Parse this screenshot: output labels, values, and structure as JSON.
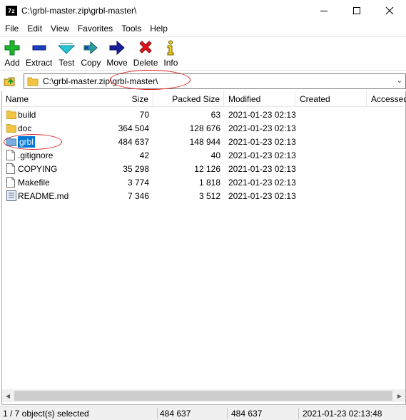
{
  "window": {
    "app_icon_text": "7z",
    "title": "C:\\grbl-master.zip\\grbl-master\\"
  },
  "menu": [
    "File",
    "Edit",
    "View",
    "Favorites",
    "Tools",
    "Help"
  ],
  "toolbar": {
    "add": "Add",
    "extract": "Extract",
    "test": "Test",
    "copy": "Copy",
    "move": "Move",
    "delete": "Delete",
    "info": "Info"
  },
  "address": {
    "path": "C:\\grbl-master.zip\\grbl-master\\"
  },
  "columns": {
    "name": "Name",
    "size": "Size",
    "packed": "Packed Size",
    "modified": "Modified",
    "created": "Created",
    "accessed": "Accessed"
  },
  "files": [
    {
      "name": "build",
      "size": "70",
      "packed": "63",
      "modified": "2021-01-23 02:13",
      "type": "folder"
    },
    {
      "name": "doc",
      "size": "364 504",
      "packed": "128 676",
      "modified": "2021-01-23 02:13",
      "type": "folder"
    },
    {
      "name": "grbl",
      "size": "484 637",
      "packed": "148 944",
      "modified": "2021-01-23 02:13",
      "type": "folder-selected"
    },
    {
      "name": ".gitignore",
      "size": "42",
      "packed": "40",
      "modified": "2021-01-23 02:13",
      "type": "file"
    },
    {
      "name": "COPYING",
      "size": "35 298",
      "packed": "12 126",
      "modified": "2021-01-23 02:13",
      "type": "file"
    },
    {
      "name": "Makefile",
      "size": "3 774",
      "packed": "1 818",
      "modified": "2021-01-23 02:13",
      "type": "file"
    },
    {
      "name": "README.md",
      "size": "7 346",
      "packed": "3 512",
      "modified": "2021-01-23 02:13",
      "type": "textfile"
    }
  ],
  "status": {
    "selection": "1 / 7 object(s) selected",
    "size": "484 637",
    "packed": "484 637",
    "modified": "2021-01-23 02:13:48"
  },
  "colors": {
    "selection": "#0078d7",
    "annotation": "#e02020",
    "folder": "#f4c542"
  }
}
